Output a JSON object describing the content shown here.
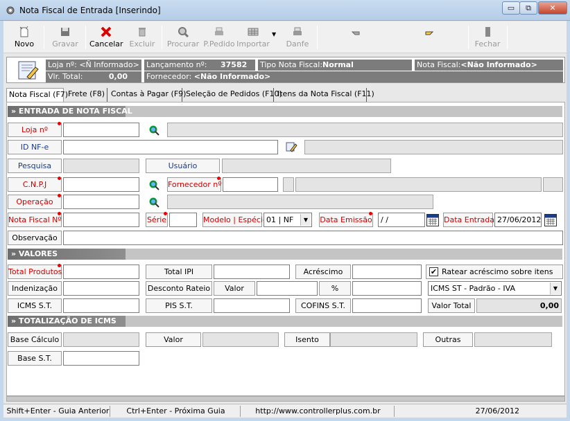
{
  "window": {
    "title": "Nota Fiscal de Entrada [Inserindo]",
    "minimize": "▭",
    "restore": "⧉",
    "close": "✕"
  },
  "toolbar": {
    "novo": "Novo",
    "gravar": "Gravar",
    "cancelar": "Cancelar",
    "excluir": "Excluir",
    "procurar": "Procurar",
    "ppedido": "P.Pedido",
    "importar": "Importar",
    "danfe": "Danfe",
    "fechar": "Fechar"
  },
  "header": {
    "loja": "Loja nº: <Ñ Informado>",
    "lancamento_label": "Lançamento nº:",
    "lancamento_value": "37582",
    "tipo_label": "Tipo Nota Fiscal:",
    "tipo_value": "Normal",
    "nota_label": "Nota Fiscal:",
    "nota_value": "<Não Informado>",
    "vlr_label": "Vlr. Total:",
    "vlr_value": "0,00",
    "fornecedor_label": "Fornecedor:",
    "fornecedor_value": "<Não Informado>"
  },
  "tabs": [
    "Nota Fiscal (F7)",
    "Frete (F8)",
    "Contas à Pagar (F9)",
    "Seleção de Pedidos (F10)",
    "Itens da Nota Fiscal (F11)"
  ],
  "sections": {
    "entrada": "» ENTRADA DE NOTA FISCAL",
    "valores": "» VALORES",
    "icms": "» TOTALIZAÇÃO DE ICMS"
  },
  "entrada": {
    "loja": "Loja nº",
    "idnfe": "ID NF-e",
    "pesquisa": "Pesquisa",
    "usuario": "Usuário",
    "cnpj": "C.N.P.J",
    "fornecedor": "Fornecedor nº",
    "operacao": "Operação",
    "notafiscal": "Nota Fiscal Nº",
    "serie": "Série",
    "modelo": "Modelo | Espécie",
    "modelo_value": "01 | NF",
    "dataemissao": "Data Emissão",
    "dataemissao_value": " / /",
    "dataentrada": "Data Entrada",
    "dataentrada_value": "27/06/2012",
    "observacao": "Observação"
  },
  "valores": {
    "totalprodutos": "Total Produtos",
    "totalipi": "Total IPI",
    "acrescimo": "Acréscimo",
    "ratear": "Ratear acréscimo sobre itens",
    "ratear_checked": "✔",
    "indenizacao": "Indenização",
    "descontorateio": "Desconto Rateio",
    "valor": "Valor",
    "percent": "%",
    "icmsst_select": "ICMS ST - Padrão - IVA",
    "icmsst": "ICMS S.T.",
    "pisst": "PIS S.T.",
    "cofinsst": "COFINS S.T.",
    "valortotal": "Valor Total",
    "valortotal_value": "0,00"
  },
  "icms": {
    "basecalculo": "Base Cálculo",
    "valor": "Valor",
    "isento": "Isento",
    "outras": "Outras",
    "basest": "Base S.T."
  },
  "status": {
    "anterior": "Shift+Enter - Guia Anterior",
    "proxima": "Ctrl+Enter - Próxima Guia",
    "url": "http://www.controllerplus.com.br",
    "date": "27/06/2012"
  }
}
